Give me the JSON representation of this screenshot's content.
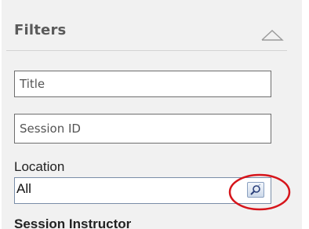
{
  "filters": {
    "title": "Filters",
    "collapse_icon": "chevron-up-outline-icon",
    "title_field": {
      "placeholder": "Title",
      "value": ""
    },
    "session_id_field": {
      "placeholder": "Session ID",
      "value": ""
    },
    "location": {
      "label": "Location",
      "selected_value": "All",
      "lookup_icon": "lookup-icon"
    },
    "next_section_label": "Session Instructor"
  },
  "colors": {
    "panel_background": "#f1f1f1",
    "highlight_circle": "#d6151b"
  }
}
